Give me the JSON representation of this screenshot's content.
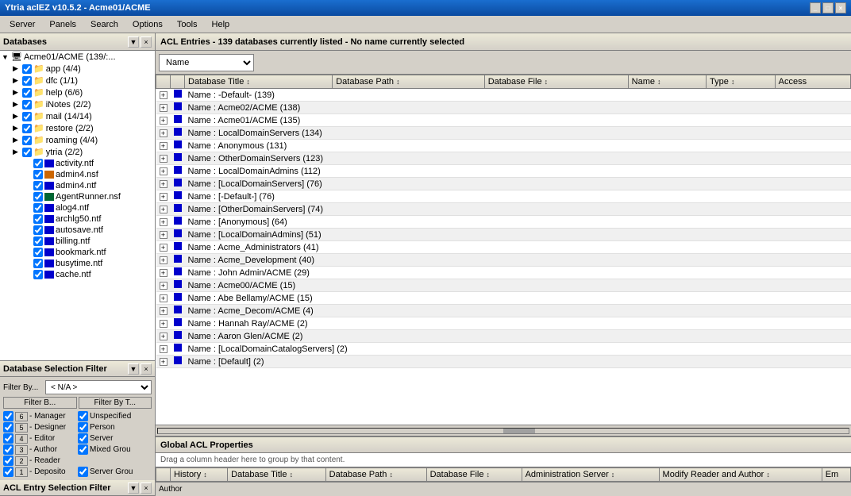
{
  "app": {
    "title": "Ytria aclEZ v10.5.2 - Acme01/ACME",
    "version": "v10.5.2"
  },
  "menu": {
    "items": [
      "Server",
      "Panels",
      "Search",
      "Options",
      "Tools",
      "Help"
    ]
  },
  "left_panel": {
    "header": "Databases",
    "tree": {
      "root": "Acme01/ACME (139/:...",
      "nodes": [
        {
          "label": "app (4/4)",
          "indent": 1,
          "type": "folder",
          "checked": true
        },
        {
          "label": "dfc (1/1)",
          "indent": 1,
          "type": "folder",
          "checked": true
        },
        {
          "label": "help (6/6)",
          "indent": 1,
          "type": "folder",
          "checked": true
        },
        {
          "label": "iNotes (2/2)",
          "indent": 1,
          "type": "folder",
          "checked": true
        },
        {
          "label": "mail (14/14)",
          "indent": 1,
          "type": "folder",
          "checked": true
        },
        {
          "label": "restore (2/2)",
          "indent": 1,
          "type": "folder",
          "checked": true
        },
        {
          "label": "roaming (4/4)",
          "indent": 1,
          "type": "folder",
          "checked": true
        },
        {
          "label": "ytria (2/2)",
          "indent": 1,
          "type": "folder",
          "checked": true
        },
        {
          "label": "activity.ntf",
          "indent": 2,
          "type": "db_blue",
          "checked": true
        },
        {
          "label": "admin4.nsf",
          "indent": 2,
          "type": "db_person",
          "checked": true
        },
        {
          "label": "admin4.ntf",
          "indent": 2,
          "type": "db_blue",
          "checked": true
        },
        {
          "label": "AgentRunner.nsf",
          "indent": 2,
          "type": "db_agent",
          "checked": true
        },
        {
          "label": "alog4.ntf",
          "indent": 2,
          "type": "db_blue",
          "checked": true
        },
        {
          "label": "archlg50.ntf",
          "indent": 2,
          "type": "db_blue",
          "checked": true
        },
        {
          "label": "autosave.ntf",
          "indent": 2,
          "type": "db_blue",
          "checked": true
        },
        {
          "label": "billing.ntf",
          "indent": 2,
          "type": "db_blue",
          "checked": true
        },
        {
          "label": "bookmark.ntf",
          "indent": 2,
          "type": "db_blue",
          "checked": true
        },
        {
          "label": "busytime.ntf",
          "indent": 2,
          "type": "db_blue",
          "checked": true
        },
        {
          "label": "cache.ntf",
          "indent": 2,
          "type": "db_blue",
          "checked": true
        }
      ]
    }
  },
  "database_filter": {
    "header": "Database Selection Filter",
    "filter_by_label": "Filter By...",
    "filter_value": "< N/A >",
    "btn_filter_b": "Filter B...",
    "btn_filter_t": "Filter By T...",
    "checkboxes": [
      {
        "level": "6",
        "label": "- Manager",
        "checked": true,
        "right_label": "Unspecified",
        "right_checked": true
      },
      {
        "level": "5",
        "label": "- Designer",
        "checked": true,
        "right_label": "Person",
        "right_checked": true
      },
      {
        "level": "4",
        "label": "- Editor",
        "checked": true,
        "right_label": "Server",
        "right_checked": true
      },
      {
        "level": "3",
        "label": "- Author",
        "checked": true,
        "right_label": "Mixed Grou",
        "right_checked": true
      },
      {
        "level": "2",
        "label": "- Reader",
        "checked": true,
        "right_label": "",
        "right_checked": false
      },
      {
        "level": "1",
        "label": "- Deposito",
        "checked": true,
        "right_label": "Server Grou",
        "right_checked": true
      }
    ]
  },
  "acl_entry_filter": {
    "header": "ACL Entry Selection Filter"
  },
  "main_header": "ACL Entries - 139 databases currently listed - No name currently selected",
  "toolbar": {
    "sort_by": "Name",
    "sort_options": [
      "Name",
      "Database Title",
      "Database Path",
      "Database File",
      "Type",
      "Access"
    ]
  },
  "table": {
    "columns": [
      "",
      "",
      "Database Title",
      "",
      "Database Path",
      "",
      "Database File",
      "",
      "Name",
      "",
      "",
      "Type",
      "",
      "Access"
    ],
    "headers": [
      "",
      "",
      "Database Title",
      "Database Path",
      "Database File",
      "Name",
      "Type",
      "Access"
    ],
    "rows": [
      {
        "label": "Name : -Default- (139)"
      },
      {
        "label": "Name : Acme02/ACME (138)"
      },
      {
        "label": "Name : Acme01/ACME (135)"
      },
      {
        "label": "Name : LocalDomainServers (134)"
      },
      {
        "label": "Name : Anonymous (131)"
      },
      {
        "label": "Name : OtherDomainServers (123)"
      },
      {
        "label": "Name : LocalDomainAdmins (112)"
      },
      {
        "label": "Name : [LocalDomainServers] (76)"
      },
      {
        "label": "Name : [-Default-] (76)"
      },
      {
        "label": "Name : [OtherDomainServers] (74)"
      },
      {
        "label": "Name : [Anonymous] (64)"
      },
      {
        "label": "Name : [LocalDomainAdmins] (51)"
      },
      {
        "label": "Name : Acme_Administrators (41)"
      },
      {
        "label": "Name : Acme_Development (40)"
      },
      {
        "label": "Name : John Admin/ACME (29)"
      },
      {
        "label": "Name : Acme00/ACME (15)"
      },
      {
        "label": "Name : Abe Bellamy/ACME (15)"
      },
      {
        "label": "Name : Acme_Decom/ACME (4)"
      },
      {
        "label": "Name : Hannah Ray/ACME (2)"
      },
      {
        "label": "Name : Aaron Glen/ACME (2)"
      },
      {
        "label": "Name : [LocalDomainCatalogServers] (2)"
      },
      {
        "label": "Name : [Default] (2)"
      }
    ]
  },
  "global_acl": {
    "header": "Global ACL Properties",
    "drag_hint": "Drag a column header here to group by that content.",
    "bottom_columns": [
      "",
      "History",
      "",
      "Database Title",
      "",
      "Database Path",
      "",
      "Database File",
      "",
      "Administration Server",
      "",
      "Modify Reader and Author",
      "",
      "Em"
    ]
  },
  "author_bar": {
    "label": "Author"
  },
  "history_label": "History"
}
